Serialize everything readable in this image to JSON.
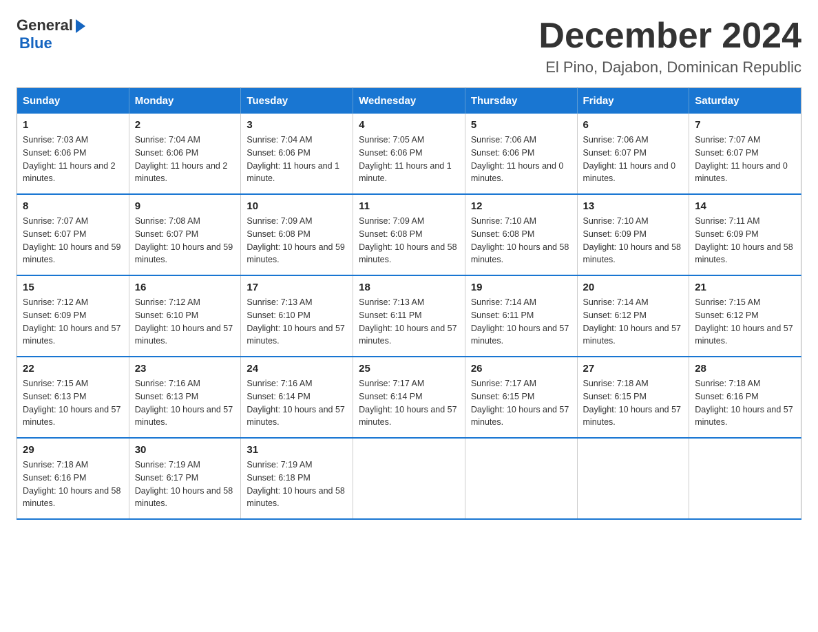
{
  "header": {
    "logo_general": "General",
    "logo_blue": "Blue",
    "title": "December 2024",
    "subtitle": "El Pino, Dajabon, Dominican Republic"
  },
  "weekdays": [
    "Sunday",
    "Monday",
    "Tuesday",
    "Wednesday",
    "Thursday",
    "Friday",
    "Saturday"
  ],
  "weeks": [
    [
      {
        "day": "1",
        "sunrise": "7:03 AM",
        "sunset": "6:06 PM",
        "daylight": "11 hours and 2 minutes."
      },
      {
        "day": "2",
        "sunrise": "7:04 AM",
        "sunset": "6:06 PM",
        "daylight": "11 hours and 2 minutes."
      },
      {
        "day": "3",
        "sunrise": "7:04 AM",
        "sunset": "6:06 PM",
        "daylight": "11 hours and 1 minute."
      },
      {
        "day": "4",
        "sunrise": "7:05 AM",
        "sunset": "6:06 PM",
        "daylight": "11 hours and 1 minute."
      },
      {
        "day": "5",
        "sunrise": "7:06 AM",
        "sunset": "6:06 PM",
        "daylight": "11 hours and 0 minutes."
      },
      {
        "day": "6",
        "sunrise": "7:06 AM",
        "sunset": "6:07 PM",
        "daylight": "11 hours and 0 minutes."
      },
      {
        "day": "7",
        "sunrise": "7:07 AM",
        "sunset": "6:07 PM",
        "daylight": "11 hours and 0 minutes."
      }
    ],
    [
      {
        "day": "8",
        "sunrise": "7:07 AM",
        "sunset": "6:07 PM",
        "daylight": "10 hours and 59 minutes."
      },
      {
        "day": "9",
        "sunrise": "7:08 AM",
        "sunset": "6:07 PM",
        "daylight": "10 hours and 59 minutes."
      },
      {
        "day": "10",
        "sunrise": "7:09 AM",
        "sunset": "6:08 PM",
        "daylight": "10 hours and 59 minutes."
      },
      {
        "day": "11",
        "sunrise": "7:09 AM",
        "sunset": "6:08 PM",
        "daylight": "10 hours and 58 minutes."
      },
      {
        "day": "12",
        "sunrise": "7:10 AM",
        "sunset": "6:08 PM",
        "daylight": "10 hours and 58 minutes."
      },
      {
        "day": "13",
        "sunrise": "7:10 AM",
        "sunset": "6:09 PM",
        "daylight": "10 hours and 58 minutes."
      },
      {
        "day": "14",
        "sunrise": "7:11 AM",
        "sunset": "6:09 PM",
        "daylight": "10 hours and 58 minutes."
      }
    ],
    [
      {
        "day": "15",
        "sunrise": "7:12 AM",
        "sunset": "6:09 PM",
        "daylight": "10 hours and 57 minutes."
      },
      {
        "day": "16",
        "sunrise": "7:12 AM",
        "sunset": "6:10 PM",
        "daylight": "10 hours and 57 minutes."
      },
      {
        "day": "17",
        "sunrise": "7:13 AM",
        "sunset": "6:10 PM",
        "daylight": "10 hours and 57 minutes."
      },
      {
        "day": "18",
        "sunrise": "7:13 AM",
        "sunset": "6:11 PM",
        "daylight": "10 hours and 57 minutes."
      },
      {
        "day": "19",
        "sunrise": "7:14 AM",
        "sunset": "6:11 PM",
        "daylight": "10 hours and 57 minutes."
      },
      {
        "day": "20",
        "sunrise": "7:14 AM",
        "sunset": "6:12 PM",
        "daylight": "10 hours and 57 minutes."
      },
      {
        "day": "21",
        "sunrise": "7:15 AM",
        "sunset": "6:12 PM",
        "daylight": "10 hours and 57 minutes."
      }
    ],
    [
      {
        "day": "22",
        "sunrise": "7:15 AM",
        "sunset": "6:13 PM",
        "daylight": "10 hours and 57 minutes."
      },
      {
        "day": "23",
        "sunrise": "7:16 AM",
        "sunset": "6:13 PM",
        "daylight": "10 hours and 57 minutes."
      },
      {
        "day": "24",
        "sunrise": "7:16 AM",
        "sunset": "6:14 PM",
        "daylight": "10 hours and 57 minutes."
      },
      {
        "day": "25",
        "sunrise": "7:17 AM",
        "sunset": "6:14 PM",
        "daylight": "10 hours and 57 minutes."
      },
      {
        "day": "26",
        "sunrise": "7:17 AM",
        "sunset": "6:15 PM",
        "daylight": "10 hours and 57 minutes."
      },
      {
        "day": "27",
        "sunrise": "7:18 AM",
        "sunset": "6:15 PM",
        "daylight": "10 hours and 57 minutes."
      },
      {
        "day": "28",
        "sunrise": "7:18 AM",
        "sunset": "6:16 PM",
        "daylight": "10 hours and 57 minutes."
      }
    ],
    [
      {
        "day": "29",
        "sunrise": "7:18 AM",
        "sunset": "6:16 PM",
        "daylight": "10 hours and 58 minutes."
      },
      {
        "day": "30",
        "sunrise": "7:19 AM",
        "sunset": "6:17 PM",
        "daylight": "10 hours and 58 minutes."
      },
      {
        "day": "31",
        "sunrise": "7:19 AM",
        "sunset": "6:18 PM",
        "daylight": "10 hours and 58 minutes."
      },
      null,
      null,
      null,
      null
    ]
  ]
}
